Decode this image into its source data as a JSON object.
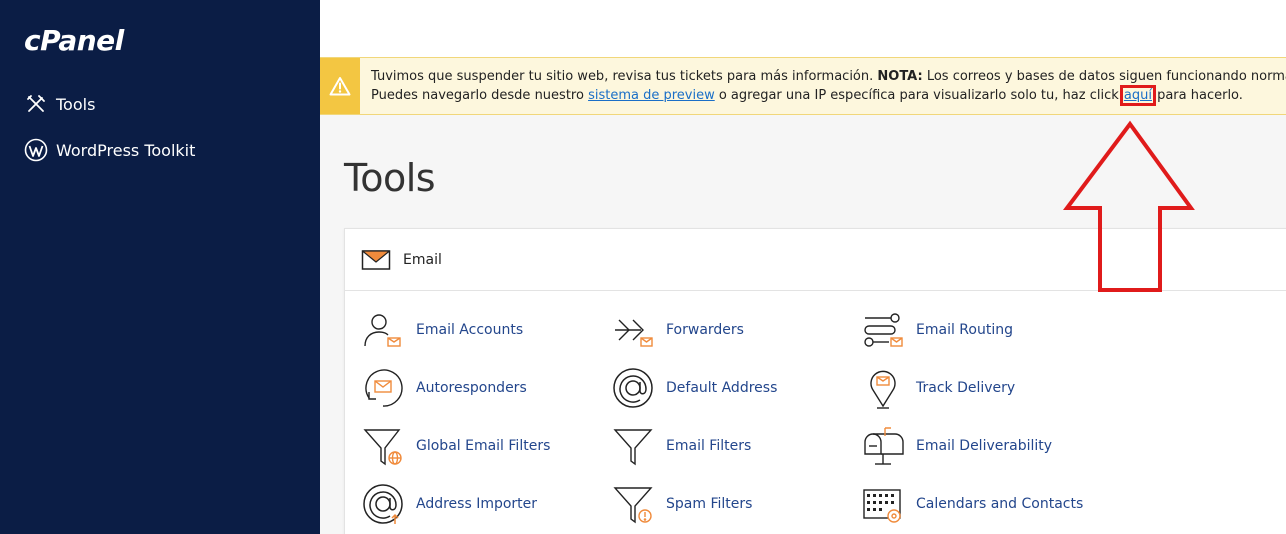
{
  "brand": {
    "logo": "cPanel"
  },
  "sidebar": {
    "items": [
      {
        "label": "Tools",
        "icon": "tools-icon"
      },
      {
        "label": "WordPress Toolkit",
        "icon": "wordpress-icon"
      }
    ]
  },
  "alert": {
    "part1": "Tuvimos que suspender tu sitio web, revisa tus tickets para más información. ",
    "nota": "NOTA:",
    "part2": " Los correos y bases de datos siguen funcionando normalmente.",
    "part3": "Puedes navegarlo desde nuestro ",
    "preview_link": "sistema de preview",
    "part4": " o agregar una IP específica para visualizarlo solo tu, haz click ",
    "here_link": "aquí",
    "part5": " para hacerlo."
  },
  "page": {
    "title": "Tools"
  },
  "email_panel": {
    "heading": "Email",
    "tools": [
      {
        "label": "Email Accounts",
        "icon": "email-accounts-icon"
      },
      {
        "label": "Forwarders",
        "icon": "forwarders-icon"
      },
      {
        "label": "Email Routing",
        "icon": "email-routing-icon"
      },
      {
        "label": "Autoresponders",
        "icon": "autoresponders-icon"
      },
      {
        "label": "Default Address",
        "icon": "default-address-icon"
      },
      {
        "label": "Track Delivery",
        "icon": "track-delivery-icon"
      },
      {
        "label": "Global Email Filters",
        "icon": "global-filter-icon"
      },
      {
        "label": "Email Filters",
        "icon": "email-filter-icon"
      },
      {
        "label": "Email Deliverability",
        "icon": "mailbox-icon"
      },
      {
        "label": "Address Importer",
        "icon": "address-importer-icon"
      },
      {
        "label": "Spam Filters",
        "icon": "spam-filter-icon"
      },
      {
        "label": "Calendars and Contacts",
        "icon": "calendar-icon"
      }
    ]
  },
  "colors": {
    "sidebar": "#0b1d45",
    "alert_bg": "#fdf7dd",
    "alert_accent": "#f3c642",
    "link": "#1b6fc7",
    "tool_label": "#23468c",
    "icon_accent": "#f08b3c",
    "annotation": "#e01b1b"
  }
}
